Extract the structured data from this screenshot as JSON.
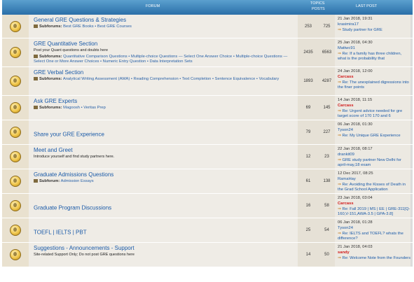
{
  "header": {
    "forum": "FORUM",
    "topics": "TOPICS",
    "posts": "POSTS",
    "last_post": "LAST POST"
  },
  "forums": [
    {
      "title": "General GRE Questions & Strategies",
      "subforums_label": "Subforums:",
      "subforums": "Best GRE Books • Best GRE Courses",
      "description": "",
      "topics": "253",
      "posts": "725",
      "date": "21 Jan 2018, 19:31",
      "user": "krasimira17",
      "user_red": false,
      "lastpost": "Study partner for GRE"
    },
    {
      "title": "GRE Quantitative Section",
      "description": "Post your Quant questions and doubts here",
      "subforums_label": "Subforums:",
      "subforums": "Quantitative Comparison Questions • Multiple-choice Questions — Select One Answer Choice • Multiple-choice Questions — Select One or More Answer Choices • Numeric Entry Question • Data Interpretation Sets",
      "topics": "2435",
      "posts": "6563",
      "date": "25 Jan 2018, 04:30",
      "user": "Mattwc91",
      "user_red": false,
      "lastpost": "Re: If a family has three children, what is the probability that"
    },
    {
      "title": "GRE Verbal Section",
      "description": "",
      "subforums_label": "Subforums:",
      "subforums": "Analytical Writing Assessment (AWA) • Reading Comprehension • Text Completion • Sentence Equivalence • Vocabulary",
      "topics": "1893",
      "posts": "4287",
      "date": "24 Jan 2018, 12:00",
      "user": "Carcass",
      "user_red": true,
      "lastpost": "Re: The unexplained digressions into the finer points"
    },
    {
      "title": "Ask GRE Experts",
      "description": "",
      "subforums_label": "Subforums:",
      "subforums": "Magoosh • Veritas Prep",
      "topics": "69",
      "posts": "145",
      "date": "14 Jan 2018, 11:15",
      "user": "Carcass",
      "user_red": true,
      "lastpost": "Re: Urgent advice needed for gre target score of 170 170 and 6"
    },
    {
      "title": "Share your GRE Experience",
      "description": "",
      "subforums_label": "",
      "subforums": "",
      "topics": "79",
      "posts": "227",
      "date": "06 Jan 2018, 01:30",
      "user": "Tyson24",
      "user_red": false,
      "lastpost": "Re: My Unique GRE Experience"
    },
    {
      "title": "Meet and Greet",
      "description": "Introduce yourself and find study partners here.",
      "subforums_label": "",
      "subforums": "",
      "topics": "12",
      "posts": "23",
      "date": "22 Jan 2018, 08:17",
      "user": "drankit09",
      "user_red": false,
      "lastpost": "GRE study partner New Delhi for april-may,18 exam"
    },
    {
      "title": "Graduate Admissions Questions",
      "description": "",
      "subforums_label": "Subforum:",
      "subforums": "Admission Essays",
      "topics": "61",
      "posts": "138",
      "date": "12 Dec 2017, 08:25",
      "user": "RamaHay",
      "user_red": false,
      "lastpost": "Re: Avoiding the Kisses of Death in the Grad School Application"
    },
    {
      "title": "Graduate Program Discussions",
      "description": "",
      "subforums_label": "",
      "subforums": "",
      "topics": "16",
      "posts": "58",
      "date": "23 Jan 2018, 03:04",
      "user": "Carcass",
      "user_red": true,
      "lastpost": "Re: Fall 2019 | MS | EE | GRE-311[Q-160,V-151,AWA-3.5 | GPA-3.8]"
    },
    {
      "title": "TOEFL | IELTS | PBT",
      "description": "",
      "subforums_label": "",
      "subforums": "",
      "topics": "25",
      "posts": "54",
      "date": "06 Jan 2018, 01:28",
      "user": "Tyson24",
      "user_red": false,
      "lastpost": "Re: IELTS and TOEFL? whats the difference?"
    },
    {
      "title": "Suggestions - Announcements - Support",
      "description": "Site-related Support Only; Do not post GRE questions here",
      "subforums_label": "",
      "subforums": "",
      "topics": "14",
      "posts": "50",
      "date": "21 Jan 2018, 04:03",
      "user": "sandy",
      "user_red": true,
      "lastpost": "Re: Welcome Note from the Founders"
    }
  ]
}
